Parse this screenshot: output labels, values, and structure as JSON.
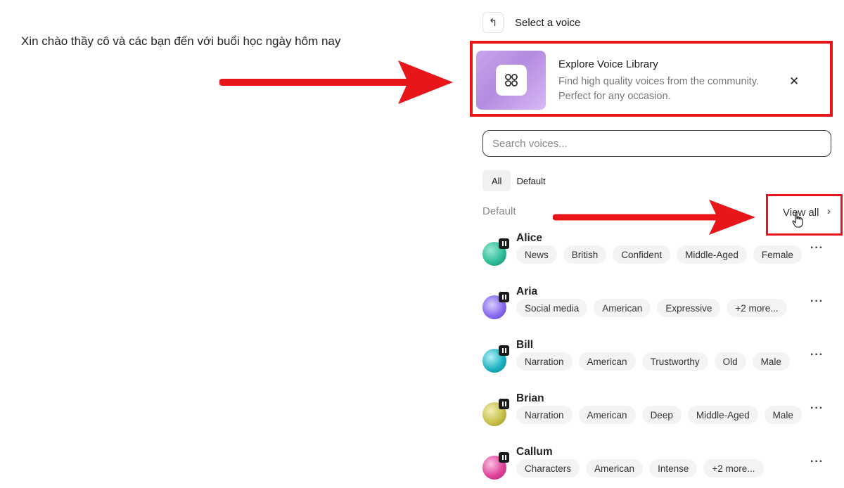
{
  "editor": {
    "text": "Xin chào thầy cô và các bạn đến với buổi học ngày hôm nay"
  },
  "header": {
    "back_icon": "undo-arrow-icon",
    "title": "Select a voice"
  },
  "explore": {
    "icon": "grid-four-circles-icon",
    "title": "Explore Voice Library",
    "description": "Find high quality voices from the community. Perfect for any occasion.",
    "close_icon": "close-icon"
  },
  "search": {
    "placeholder": "Search voices..."
  },
  "filters": [
    "All",
    "Default"
  ],
  "section": {
    "label": "Default",
    "view_all": "View all"
  },
  "voices": [
    {
      "name": "Alice",
      "tags": [
        "News",
        "British",
        "Confident",
        "Middle-Aged",
        "Female"
      ]
    },
    {
      "name": "Aria",
      "tags": [
        "Social media",
        "American",
        "Expressive",
        "+2 more..."
      ]
    },
    {
      "name": "Bill",
      "tags": [
        "Narration",
        "American",
        "Trustworthy",
        "Old",
        "Male"
      ]
    },
    {
      "name": "Brian",
      "tags": [
        "Narration",
        "American",
        "Deep",
        "Middle-Aged",
        "Male"
      ]
    },
    {
      "name": "Callum",
      "tags": [
        "Characters",
        "American",
        "Intense",
        "+2 more..."
      ]
    }
  ],
  "colors": {
    "highlight": "#e8161a",
    "avatar_alice": "#2fbf9b",
    "avatar_aria": "#8a6cf0",
    "avatar_bill": "#1fb3c4",
    "avatar_brian": "#c9c24a",
    "avatar_callum": "#e0449a"
  }
}
